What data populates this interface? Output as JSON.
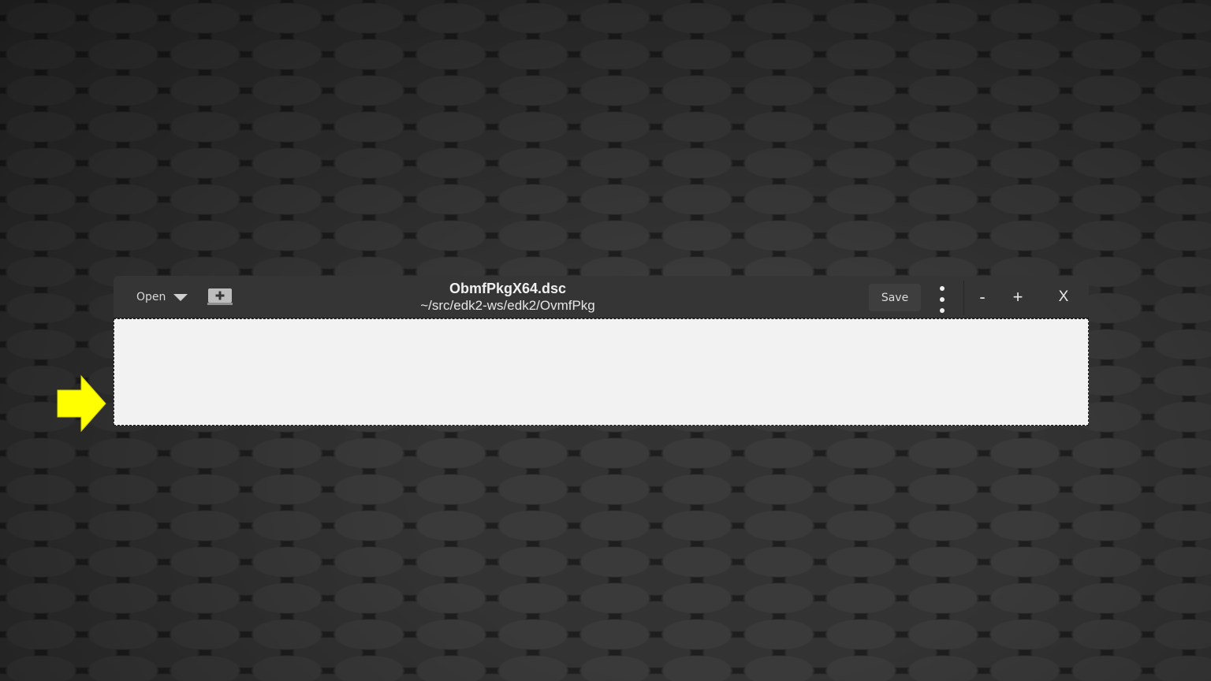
{
  "headerbar": {
    "open_label": "Open",
    "title": "ObmfPkgX64.dsc",
    "subtitle": "~/src/edk2-ws/edk2/OvmfPkg",
    "save_label": "Save",
    "minimize_label": "-",
    "maximize_label": "+",
    "close_label": "X"
  },
  "icons": {
    "open_dropdown": "chevron-down-icon",
    "new_tab": "new-document-icon",
    "menu": "vertical-ellipsis-icon",
    "annotation": "arrow-right-icon"
  },
  "colors": {
    "headerbar_bg": "#353535",
    "content_bg": "#f2f2f2",
    "annotation_arrow": "#ffff00"
  }
}
